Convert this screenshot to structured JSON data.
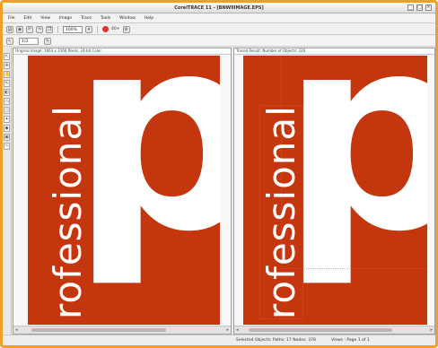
{
  "window": {
    "title": "CorelTRACE 11 - [BNW9IMAGE.EPS]",
    "controls": [
      "_",
      "□",
      "×"
    ]
  },
  "menu": [
    "File",
    "Edit",
    "View",
    "Image",
    "Trace",
    "Tools",
    "Window",
    "Help"
  ],
  "toolbar": {
    "zoom_value": "100%",
    "trace_label": "40+"
  },
  "toolbar2": {
    "field_value": "1/3"
  },
  "panes": {
    "left": {
      "header": "Original Image: 1663 x 3160 Pixels, 24-bit Color"
    },
    "right": {
      "header": "Traced Result: Number of Objects: 326"
    }
  },
  "artwork": {
    "word": "rofessional",
    "letter": "p"
  },
  "status": {
    "left": "Selected Objects: Paths: 17 Nodes: 378",
    "right": "Views : Page 1 of 1"
  },
  "colors": {
    "artwork_red": "#c4360d",
    "window_border": "#f0a028"
  }
}
